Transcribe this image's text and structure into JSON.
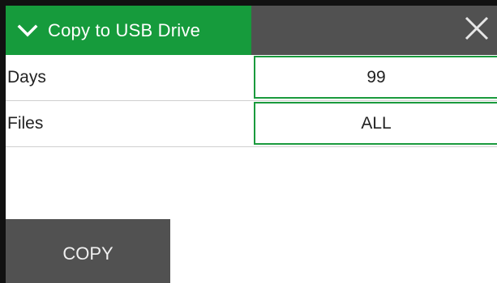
{
  "header": {
    "title": "Copy to USB Drive",
    "accent_color": "#169b3c",
    "bar_color": "#515151",
    "collapse_icon": "chevron-down-icon",
    "close_icon": "close-icon"
  },
  "rows": [
    {
      "label": "Days",
      "value": "99"
    },
    {
      "label": "Files",
      "value": "ALL"
    }
  ],
  "actions": {
    "copy_label": "COPY"
  }
}
